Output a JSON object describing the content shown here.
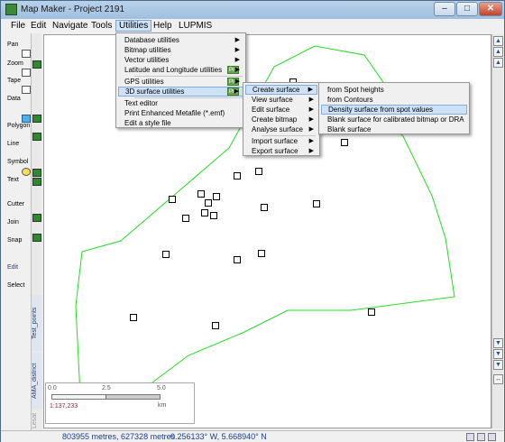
{
  "window": {
    "title": "Map Maker - Project 2191",
    "controls": {
      "minimize": "–",
      "maximize": "□",
      "close": "✕"
    }
  },
  "menubar": [
    "File",
    "Edit",
    "Navigate",
    "Tools",
    "Utilities",
    "Help",
    "LUPMIS"
  ],
  "toolbar": {
    "tools": [
      "Pan",
      "Zoom",
      "Tape",
      "Data",
      "Polygon",
      "Line",
      "Symbol",
      "Text",
      "Cutter",
      "Join",
      "Snap",
      "Edit",
      "Select"
    ]
  },
  "layers": [
    "Test_points",
    "AMA_district",
    "Lesat"
  ],
  "utilities_menu": {
    "items": [
      {
        "label": "Database utilities",
        "submenu": true
      },
      {
        "label": "Bitmap utilities",
        "submenu": true
      },
      {
        "label": "Vector utilities",
        "submenu": true
      },
      {
        "label": "Latitude and Longitude utilities",
        "submenu": true,
        "pro": "Pro"
      },
      {
        "label": "GPS utilities",
        "submenu": true,
        "pro": "Pro"
      },
      {
        "label": "3D surface utilities",
        "submenu": true,
        "pro": "Pro",
        "highlighted": true
      },
      {
        "label": "Text editor"
      },
      {
        "label": "Print Enhanced Metafile (*.emf)"
      },
      {
        "label": "Edit a style file"
      }
    ]
  },
  "surface_menu": {
    "items": [
      {
        "label": "Create surface",
        "submenu": true,
        "highlighted": true
      },
      {
        "label": "View surface",
        "submenu": true
      },
      {
        "label": "Edit surface",
        "submenu": true
      },
      {
        "label": "Create bitmap",
        "submenu": true
      },
      {
        "label": "Analyse surface",
        "submenu": true
      },
      {
        "label": "Import surface",
        "submenu": true
      },
      {
        "label": "Export surface",
        "submenu": true
      }
    ]
  },
  "create_surface_menu": {
    "items": [
      {
        "label": "from Spot heights"
      },
      {
        "label": "from Contours"
      },
      {
        "label": "Density surface from spot values",
        "highlighted": true
      },
      {
        "label": "Blank surface for calibrated bitmap or DRA"
      },
      {
        "label": "Blank surface"
      }
    ]
  },
  "scalebar": {
    "ticks": [
      "0.0",
      "2.5",
      "5.0"
    ],
    "ratio": "1:137,233",
    "unit": "km"
  },
  "status": {
    "coords_metres": "803955 metres, 627328 metres",
    "coords_latlon": "0.256133° W,  5.668940° N"
  },
  "map": {
    "boundary_color": "#22dd22",
    "point_count": 19
  }
}
